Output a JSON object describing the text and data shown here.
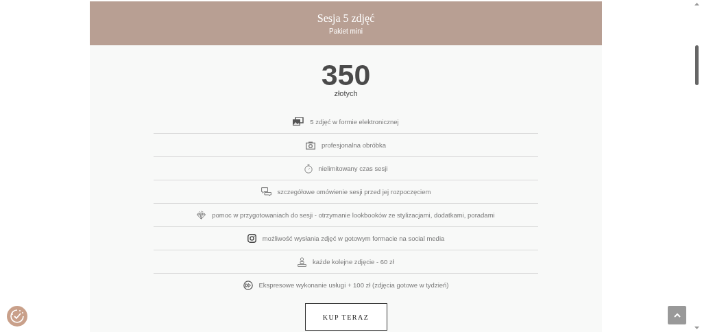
{
  "header": {
    "title": "Sesja 5 zdjęć",
    "subtitle": "Pakiet mini"
  },
  "price": {
    "amount": "350",
    "unit": "złotych"
  },
  "features": [
    {
      "text": "5 zdjęć w formie elektronicznej"
    },
    {
      "text": "profesjonalna obróbka"
    },
    {
      "text": "nielimitowany czas sesji"
    },
    {
      "text": "szczegółowe omówienie sesji przed jej rozpoczęciem"
    },
    {
      "text": "pomoc w przygotowaniach do sesji - otrzymanie lookbooków ze stylizacjami, dodatkami, poradami"
    },
    {
      "text": "możliwość wysłania zdjęć w gotowym formacie na social media"
    },
    {
      "text": "każde kolejne zdjęcie - 60 zł"
    },
    {
      "text": "Ekspresowe wykonanie usługi + 100 zł (zdjęcia gotowe w tydzień)"
    }
  ],
  "button": {
    "label": "KUP TERAZ"
  }
}
